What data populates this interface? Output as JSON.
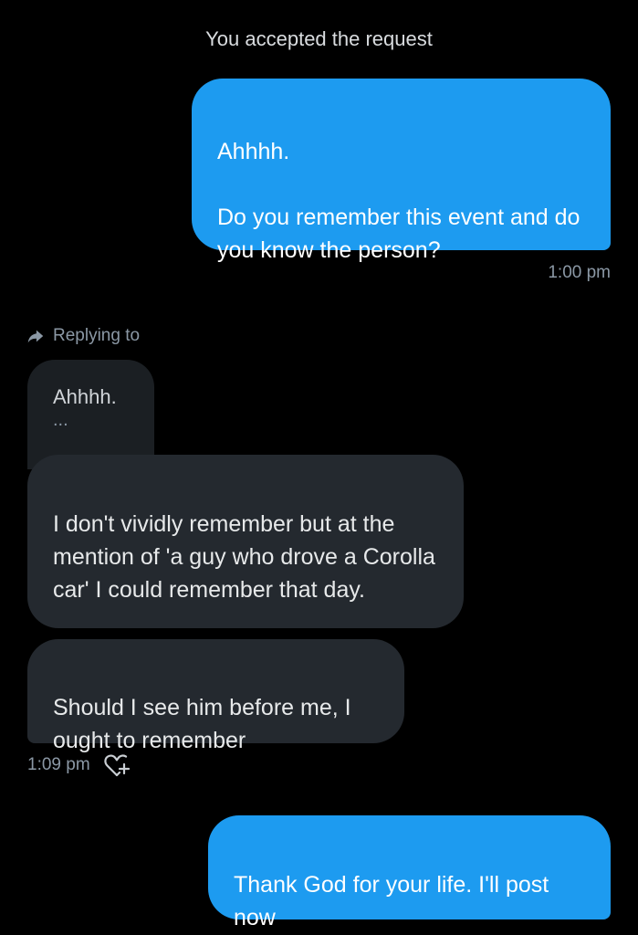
{
  "system_note": "You accepted the request",
  "messages": {
    "outgoing_1": {
      "text": "Ahhhh.\n\nDo you remember this event and do you know the person?",
      "time": "1:00 pm"
    },
    "reply_context": {
      "label": "Replying to",
      "quoted_text": "Ahhhh.",
      "quoted_ellipsis": "..."
    },
    "incoming_1": {
      "text": "I don't vividly remember but at the mention of 'a guy who drove  a Corolla car' I could remember that day."
    },
    "incoming_2": {
      "text": "Should I see him before me, I ought to remember",
      "time": "1:09 pm"
    },
    "outgoing_2": {
      "text": "Thank God for your life. I'll post now"
    }
  },
  "icons": {
    "reply_arrow": "reply-arrow-icon",
    "add_reaction": "heart-plus-icon"
  },
  "colors": {
    "background": "#000000",
    "outgoing_bubble": "#1d9bf0",
    "incoming_bubble": "#24292f",
    "muted_text": "#8b98a5"
  }
}
